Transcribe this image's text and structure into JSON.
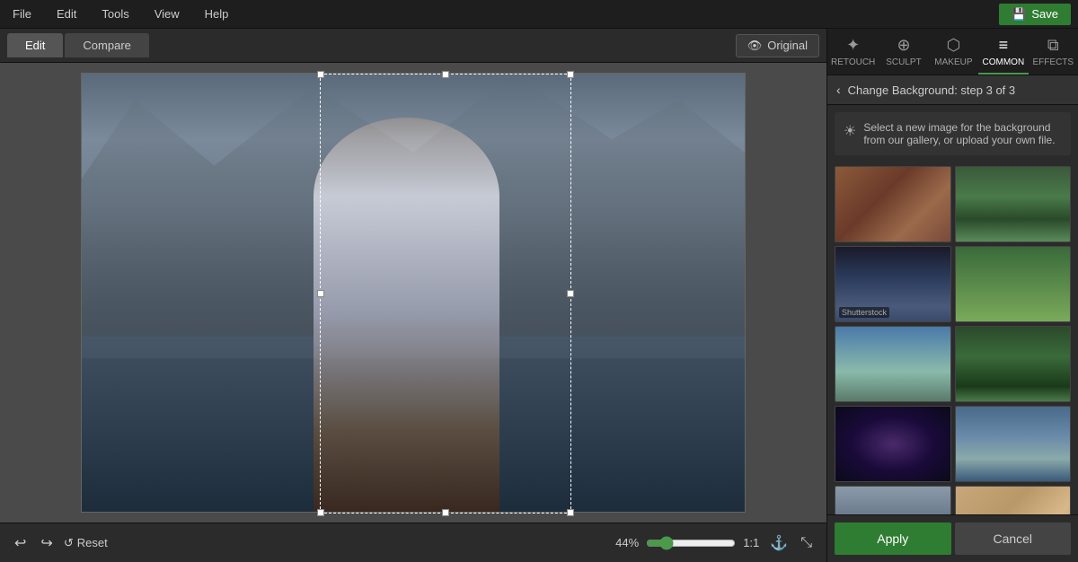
{
  "menubar": {
    "items": [
      "File",
      "Edit",
      "Tools",
      "View",
      "Help"
    ],
    "save_label": "Save"
  },
  "edit_bar": {
    "edit_tab": "Edit",
    "compare_tab": "Compare",
    "original_label": "Original"
  },
  "bottom_bar": {
    "reset_label": "Reset",
    "zoom_value": "44%",
    "zoom_ratio": "1:1"
  },
  "panel_tabs": [
    {
      "id": "retouch",
      "label": "RETOUCH",
      "icon": "✦"
    },
    {
      "id": "sculpt",
      "label": "SCULPT",
      "icon": "⊕"
    },
    {
      "id": "makeup",
      "label": "MAKEUP",
      "icon": "⊡"
    },
    {
      "id": "common",
      "label": "COMMON",
      "icon": "≡"
    },
    {
      "id": "effects",
      "label": "EFFECTS",
      "icon": "⧉"
    }
  ],
  "active_tab": "common",
  "back_nav": {
    "label": "Change Background: step 3 of 3"
  },
  "hint": {
    "text": "Select a new image for the background from our gallery, or upload your own file."
  },
  "gallery": {
    "thumbs": [
      {
        "id": 1,
        "class": "thumb-brick",
        "alt": "Brick wall"
      },
      {
        "id": 2,
        "class": "thumb-street",
        "alt": "Street trees"
      },
      {
        "id": 3,
        "class": "thumb-city",
        "alt": "City night"
      },
      {
        "id": 4,
        "class": "thumb-rainbow",
        "alt": "Rainbow field"
      },
      {
        "id": 5,
        "class": "thumb-mountains",
        "alt": "Mountain lake"
      },
      {
        "id": 6,
        "class": "thumb-forest",
        "alt": "Forest"
      },
      {
        "id": 7,
        "class": "thumb-galaxy",
        "alt": "Galaxy"
      },
      {
        "id": 8,
        "class": "thumb-fjord",
        "alt": "Fjord"
      },
      {
        "id": 9,
        "class": "thumb-church",
        "alt": "Church mountain"
      },
      {
        "id": 10,
        "class": "thumb-linen",
        "alt": "Linen texture"
      }
    ]
  },
  "actions": {
    "apply_label": "Apply",
    "cancel_label": "Cancel"
  }
}
